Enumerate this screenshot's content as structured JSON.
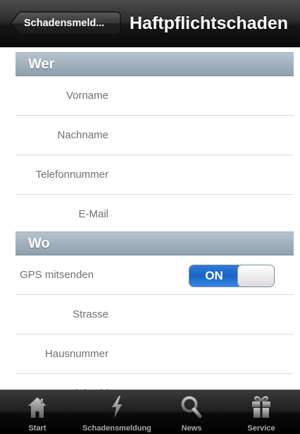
{
  "navbar": {
    "back_label": "Schadensmeld...",
    "title": "Haftpflichtschaden"
  },
  "sections": {
    "wer": {
      "header": "Wer",
      "fields": [
        {
          "label": "Vorname",
          "value": ""
        },
        {
          "label": "Nachname",
          "value": ""
        },
        {
          "label": "Telefonnummer",
          "value": ""
        },
        {
          "label": "E-Mail",
          "value": ""
        }
      ]
    },
    "wo": {
      "header": "Wo",
      "gps_label": "GPS mitsenden",
      "gps_toggle": {
        "state": "ON",
        "value": true
      },
      "fields": [
        {
          "label": "Strasse",
          "value": ""
        },
        {
          "label": "Hausnummer",
          "value": ""
        },
        {
          "label": "Postleitzahl",
          "value": ""
        }
      ]
    }
  },
  "tabbar": {
    "tabs": [
      {
        "label": "Start",
        "icon": "home-icon"
      },
      {
        "label": "Schadensmeldung",
        "icon": "lightning-icon"
      },
      {
        "label": "News",
        "icon": "magnifier-icon"
      },
      {
        "label": "Service",
        "icon": "gift-icon"
      }
    ]
  },
  "colors": {
    "toggle_on": "#1a64c5",
    "section_header": "#a1b0bd",
    "label_text": "#707070"
  }
}
